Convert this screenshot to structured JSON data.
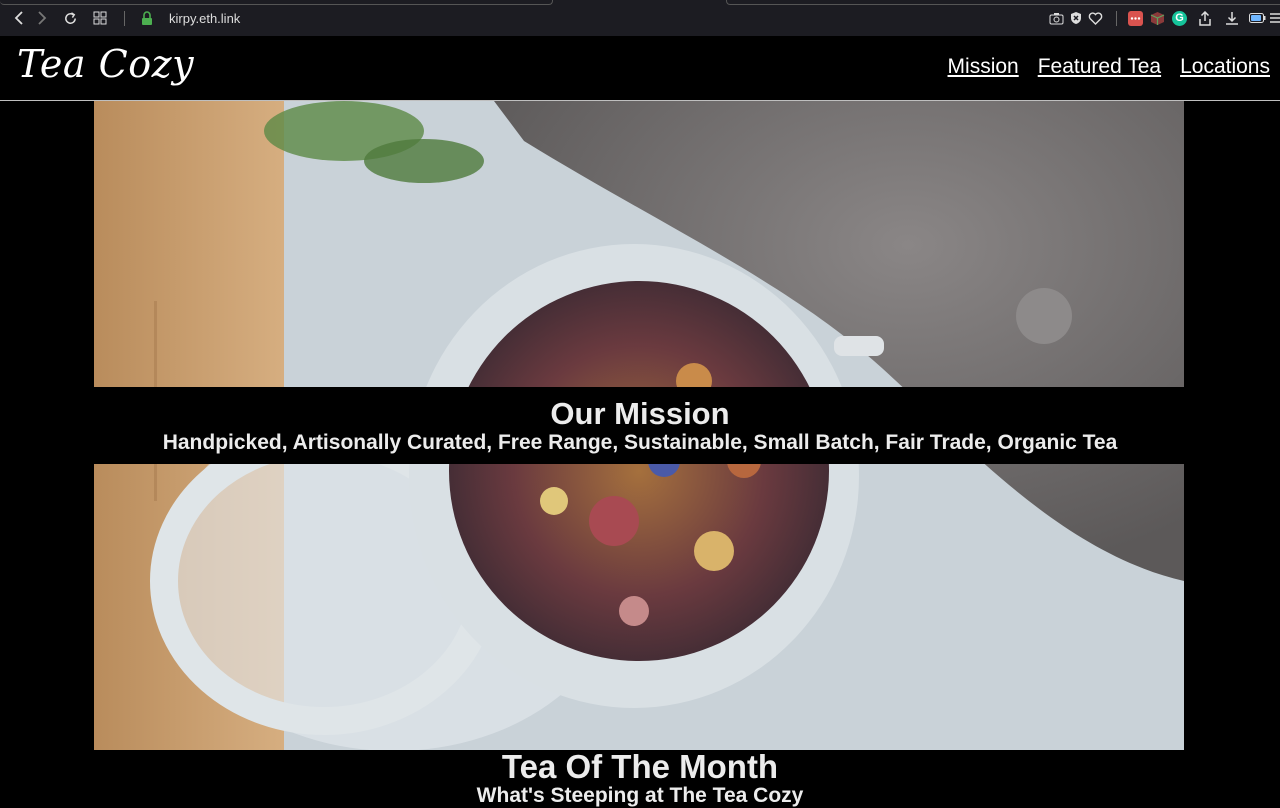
{
  "browser": {
    "url_prefix": "kirpy.",
    "url_domain": "eth.link",
    "icons": [
      "back-icon",
      "forward-icon",
      "reload-icon",
      "grid-icon",
      "lock-icon",
      "camera-icon",
      "shield-x-icon",
      "heart-icon",
      "extension-icon",
      "cube-icon",
      "grammarly-icon",
      "share-icon",
      "download-icon",
      "battery-icon",
      "menu-icon"
    ],
    "extension_badge": "G"
  },
  "nav": {
    "logo": "Tea Cozy",
    "links": [
      "Mission",
      "Featured Tea",
      "Locations"
    ]
  },
  "mission": {
    "heading": "Our Mission",
    "subheading": "Handpicked, Artisonally Curated, Free Range, Sustainable, Small Batch, Fair Trade, Organic Tea"
  },
  "tea_of_month": {
    "heading": "Tea Of The Month",
    "subheading": "What's Steeping at The Tea Cozy"
  },
  "colors": {
    "page_bg": "#000000",
    "chrome_bg": "#1c1c22",
    "lock_green": "#4caf50"
  }
}
